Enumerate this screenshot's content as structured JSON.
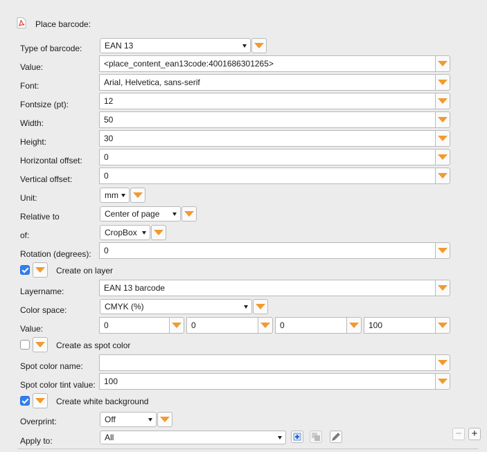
{
  "header": {
    "title": "Place barcode:",
    "icon": "pdf-icon"
  },
  "labels": {
    "type": "Type of barcode:",
    "value": "Value:",
    "font": "Font:",
    "fontsize": "Fontsize (pt):",
    "width": "Width:",
    "height": "Height:",
    "hoffset": "Horizontal offset:",
    "voffset": "Vertical offset:",
    "unit": "Unit:",
    "relative": "Relative to",
    "of": "of:",
    "rotation": "Rotation (degrees):",
    "layername": "Layername:",
    "colorspace": "Color space:",
    "colorvalue": "Value:",
    "spotname": "Spot color name:",
    "spottint": "Spot color tint value:",
    "overprint": "Overprint:",
    "applyto": "Apply to:"
  },
  "fields": {
    "type": "EAN 13",
    "value": "<place_content_ean13code:4001686301265>",
    "font": "Arial, Helvetica, sans-serif",
    "fontsize": "12",
    "width": "50",
    "height": "30",
    "hoffset": "0",
    "voffset": "0",
    "unit": "mm",
    "relative": "Center of page",
    "of": "CropBox",
    "rotation": "0",
    "layername": "EAN 13 barcode",
    "colorspace": "CMYK (%)",
    "c": "0",
    "m": "0",
    "y": "0",
    "k": "100",
    "spotname": "",
    "spottint": "100",
    "overprint": "Off",
    "applyto": "All"
  },
  "checkboxes": {
    "layer": {
      "label": "Create on layer",
      "checked": true
    },
    "spot": {
      "label": "Create as spot color",
      "checked": false
    },
    "white": {
      "label": "Create white background",
      "checked": true
    }
  },
  "buttons": {
    "minus": "−",
    "plus": "+"
  },
  "colors": {
    "accent": "#f29a2e",
    "checkbox": "#2f7ff0"
  }
}
